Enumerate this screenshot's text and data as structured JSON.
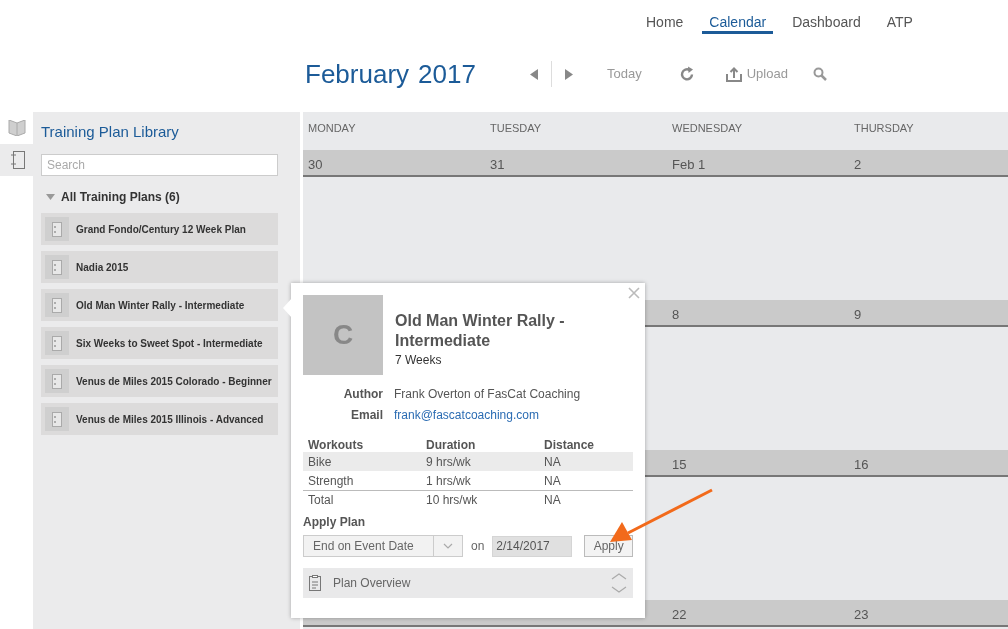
{
  "nav": [
    {
      "label": "Home",
      "selected": false
    },
    {
      "label": "Calendar",
      "selected": true
    },
    {
      "label": "Dashboard",
      "selected": false
    },
    {
      "label": "ATP",
      "selected": false
    }
  ],
  "header": {
    "month": "February",
    "year": "2017",
    "today": "Today",
    "upload": "Upload"
  },
  "rail_tabs": [
    {
      "selected": false,
      "kind": "book"
    },
    {
      "selected": true,
      "kind": "plan"
    }
  ],
  "library": {
    "title": "Training Plan Library",
    "search_placeholder": "Search",
    "group": {
      "label": "All Training Plans (6)",
      "expanded": true,
      "items": [
        {
          "label": "Grand Fondo/Century 12 Week Plan"
        },
        {
          "label": "Nadia 2015"
        },
        {
          "label": "Old Man Winter Rally - Intermediate"
        },
        {
          "label": "Six Weeks to Sweet Spot - Intermediate"
        },
        {
          "label": "Venus de Miles 2015 Colorado - Beginner"
        },
        {
          "label": "Venus de Miles 2015 Illinois - Advanced"
        }
      ]
    }
  },
  "calendar": {
    "weekdays": [
      "MONDAY",
      "TUESDAY",
      "WEDNESDAY",
      "THURSDAY"
    ],
    "weeks": [
      {
        "days": [
          "30",
          "31",
          "Feb 1",
          "2"
        ]
      },
      {
        "days": [
          "8",
          "9"
        ]
      },
      {
        "days": [
          "15",
          "16"
        ]
      },
      {
        "days": [
          "22",
          "23"
        ]
      }
    ]
  },
  "popup": {
    "avatar": "C",
    "title": "Old Man Winter Rally - Intermediate",
    "duration": "7 Weeks",
    "details": [
      {
        "label": "Author",
        "value": "Frank Overton of FasCat Coaching",
        "kind": "text"
      },
      {
        "label": "Email",
        "value": "frank@fascatcoaching.com",
        "kind": "link"
      }
    ],
    "table": {
      "columns": [
        "Workouts",
        "Duration",
        "Distance"
      ],
      "rows": [
        {
          "kind": "workout",
          "cells": [
            "Bike",
            "9 hrs/wk",
            "NA"
          ]
        },
        {
          "kind": "workout",
          "cells": [
            "Strength",
            "1 hrs/wk",
            "NA"
          ]
        },
        {
          "kind": "total",
          "cells": [
            "Total",
            "10 hrs/wk",
            "NA"
          ]
        }
      ]
    },
    "apply": {
      "label": "Apply Plan",
      "mode": "End on Event Date",
      "on": "on",
      "date": "2/14/2017",
      "button": "Apply"
    },
    "overview": {
      "label": "Plan Overview"
    }
  }
}
